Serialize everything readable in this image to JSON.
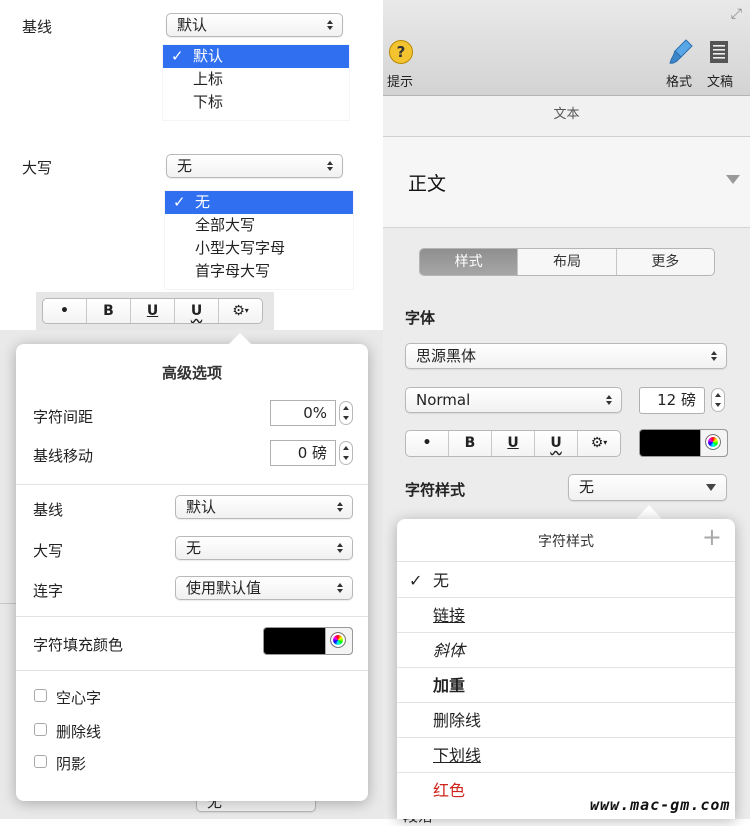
{
  "left": {
    "baseline": {
      "label": "基线",
      "value": "默认",
      "options": [
        "默认",
        "上标",
        "下标"
      ],
      "selected_index": 0
    },
    "caps": {
      "label": "大写",
      "value": "无",
      "options": [
        "无",
        "全部大写",
        "小型大写字母",
        "首字母大写"
      ],
      "selected_index": 0
    },
    "toolbar": {
      "dot": "•",
      "bold": "B",
      "underline": "U",
      "wavy": "U",
      "gear": "⚙"
    },
    "advanced": {
      "title": "高级选项",
      "char_spacing_label": "字符间距",
      "char_spacing_value": "0%",
      "baseline_shift_label": "基线移动",
      "baseline_shift_value": "0 磅",
      "baseline_label": "基线",
      "baseline_value": "默认",
      "caps_label": "大写",
      "caps_value": "无",
      "ligature_label": "连字",
      "ligature_value": "使用默认值",
      "fill_color_label": "字符填充颜色",
      "fill_color": "#000000",
      "checkboxes": [
        "空心字",
        "删除线",
        "阴影"
      ]
    },
    "bottom_partial": "无"
  },
  "right": {
    "toolbar": {
      "help_label": "提示",
      "format_label": "格式",
      "document_label": "文稿"
    },
    "section_header": "文本",
    "paragraph_style": "正文",
    "tabs": [
      "样式",
      "布局",
      "更多"
    ],
    "active_tab": 0,
    "font_heading": "字体",
    "font_family": "思源黑体",
    "font_weight": "Normal",
    "font_size": "12 磅",
    "toolbar2": {
      "dot": "•",
      "bold": "B",
      "underline": "U",
      "wavy": "U",
      "gear": "⚙"
    },
    "text_color": "#000000",
    "char_style_label": "字符样式",
    "char_style_value": "无",
    "char_style_popover": {
      "title": "字符样式",
      "add": "+",
      "items": [
        "无",
        "链接",
        "斜体",
        "加重",
        "删除线",
        "下划线",
        "红色"
      ],
      "selected_index": 0,
      "red_color": "#d0231b"
    },
    "bottom_partial": "段落"
  },
  "watermark": "www.mac-gm.com"
}
